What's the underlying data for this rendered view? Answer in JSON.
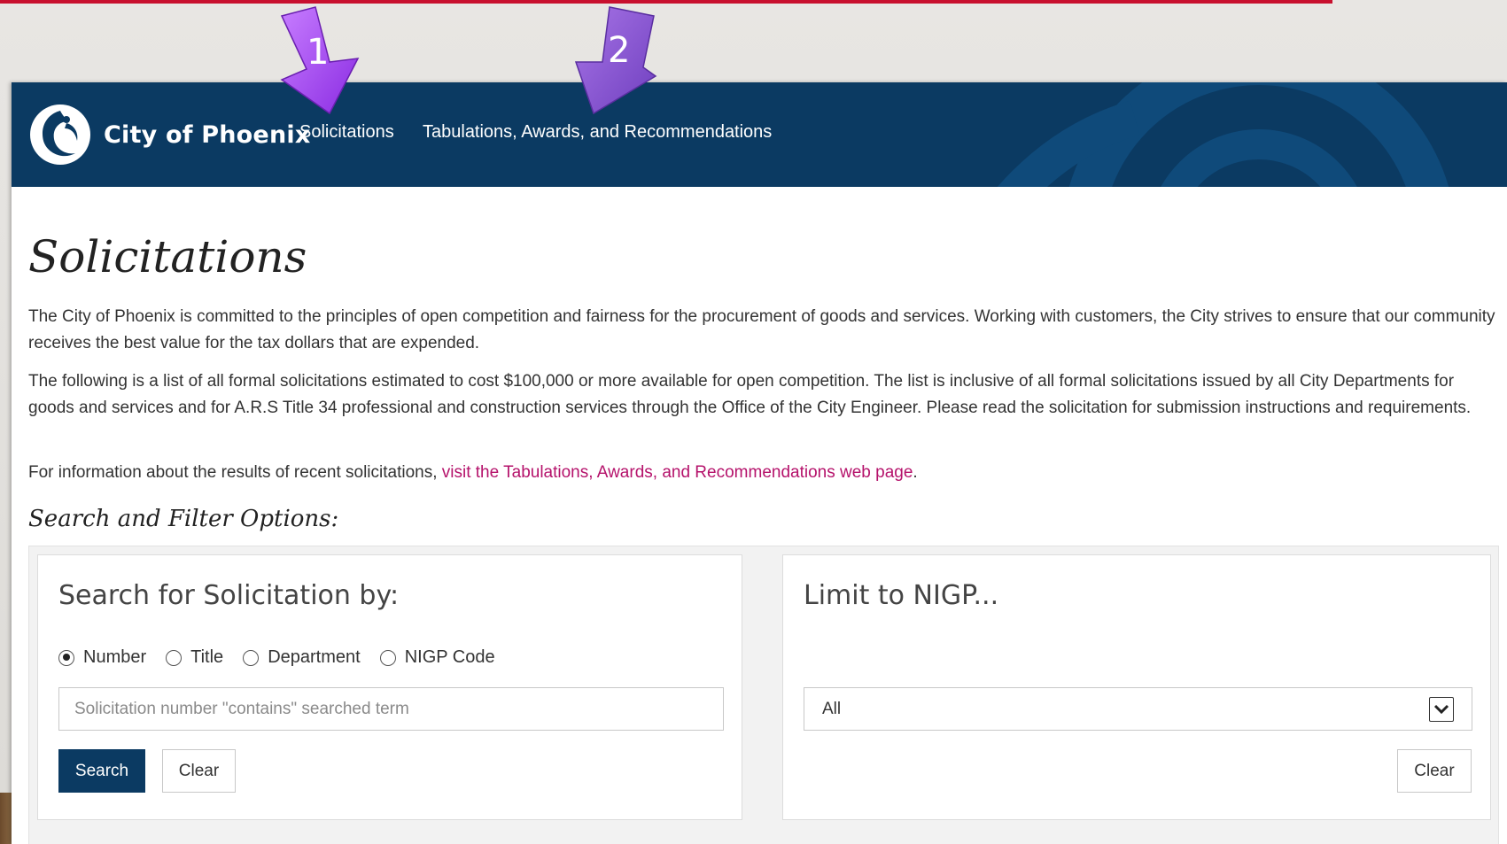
{
  "brand": {
    "name": "City of Phoenix"
  },
  "nav": {
    "items": [
      {
        "label": "Solicitations"
      },
      {
        "label": "Tabulations, Awards, and Recommendations"
      }
    ]
  },
  "annotations": [
    {
      "number": "1"
    },
    {
      "number": "2"
    }
  ],
  "page": {
    "title": "Solicitations",
    "paragraph1": "The City of Phoenix is committed to the principles of open competition and fairness for the procurement of goods and services. Working with customers, the City strives to ensure that our community receives the best value for the tax dollars that are expended.",
    "paragraph2": "The following is a list of all formal solicitations estimated to cost $100,000 or more available for open competition. The list is inclusive of all formal solicitations issued by all City Departments for goods and services and for A.R.S Title 34 professional and construction services through the Office of the City Engineer. Please read the solicitation for submission instructions and requirements.",
    "paragraph3_prefix": "For information about the results of recent solicitations, ",
    "paragraph3_link": "visit the Tabulations, Awards, and Recommendations web page",
    "paragraph3_suffix": "."
  },
  "filters": {
    "section_title": "Search and Filter Options:",
    "search_panel": {
      "heading": "Search for Solicitation by:",
      "options": [
        {
          "label": "Number",
          "checked": true
        },
        {
          "label": "Title",
          "checked": false
        },
        {
          "label": "Department",
          "checked": false
        },
        {
          "label": "NIGP Code",
          "checked": false
        }
      ],
      "input_value": "",
      "input_placeholder": "Solicitation number \"contains\" searched term",
      "search_label": "Search",
      "clear_label": "Clear"
    },
    "nigp_panel": {
      "heading": "Limit to NIGP...",
      "selected_value": "All",
      "clear_label": "Clear"
    }
  },
  "colors": {
    "navbar": "#0b3a62",
    "link": "#b5126b",
    "primary_button": "#0b3a62",
    "annotation_arrow": "#9b3fd6",
    "top_line": "#c8102e"
  }
}
